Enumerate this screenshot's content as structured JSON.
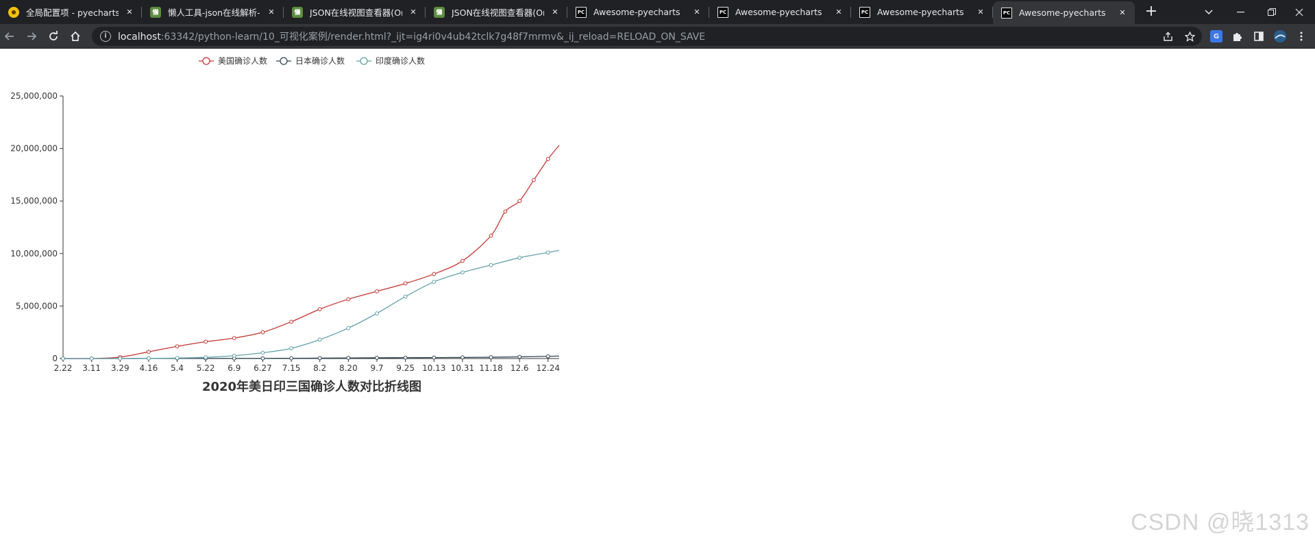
{
  "browser": {
    "tabs": [
      {
        "title": "全局配置项 - pyecharts -",
        "favicon": "pyecharts-yellow-icon",
        "active": false
      },
      {
        "title": "懒人工具-json在线解析-在",
        "favicon": "lazy-tool-green-icon",
        "active": false
      },
      {
        "title": "JSON在线视图查看器(Onl",
        "favicon": "lazy-tool-green-icon",
        "active": false
      },
      {
        "title": "JSON在线视图查看器(Onl",
        "favicon": "lazy-tool-green-icon",
        "active": false
      },
      {
        "title": "Awesome-pyecharts",
        "favicon": "pycharm-icon",
        "active": false
      },
      {
        "title": "Awesome-pyecharts",
        "favicon": "pycharm-icon",
        "active": false
      },
      {
        "title": "Awesome-pyecharts",
        "favicon": "pycharm-icon",
        "active": false
      },
      {
        "title": "Awesome-pyecharts",
        "favicon": "pycharm-icon",
        "active": true
      }
    ],
    "url_host": "localhost",
    "url_rest": ":63342/python-learn/10_可视化案例/render.html?_ijt=ig4ri0v4ub42tclk7g48f7mrmv&_ij_reload=RELOAD_ON_SAVE"
  },
  "chart_data": {
    "type": "line",
    "title": "2020年美日印三国确诊人数对比折线图",
    "legend_position": "top-left",
    "ylim": [
      0,
      25000000
    ],
    "yticks": [
      "0",
      "5,000,000",
      "10,000,000",
      "15,000,000",
      "20,000,000",
      "25,000,000"
    ],
    "ytick_values": [
      0,
      5000000,
      10000000,
      15000000,
      20000000,
      25000000
    ],
    "x_tick_labels": [
      "2.22",
      "3.11",
      "3.29",
      "4.16",
      "5.4",
      "5.22",
      "6.9",
      "6.27",
      "7.15",
      "8.2",
      "8.20",
      "9.7",
      "9.25",
      "10.13",
      "10.31",
      "11.18",
      "12.6",
      "12.24"
    ],
    "x_tick_days": [
      53,
      71,
      89,
      107,
      125,
      143,
      161,
      179,
      197,
      215,
      233,
      251,
      269,
      287,
      305,
      323,
      341,
      359
    ],
    "x_range_days": [
      53,
      366
    ],
    "series": [
      {
        "name": "美国确诊人数",
        "color": "#c23531",
        "x_days": [
          53,
          71,
          89,
          107,
          125,
          143,
          161,
          179,
          197,
          215,
          233,
          251,
          269,
          287,
          305,
          323,
          332,
          341,
          350,
          359,
          366
        ],
        "values": [
          15,
          1000,
          140000,
          640000,
          1160000,
          1600000,
          1950000,
          2500000,
          3500000,
          4700000,
          5650000,
          6400000,
          7150000,
          8050000,
          9300000,
          11700000,
          14000000,
          15000000,
          17000000,
          19000000,
          20300000
        ]
      },
      {
        "name": "日本确诊人数",
        "color": "#2f4554",
        "x_days": [
          53,
          71,
          89,
          107,
          125,
          143,
          161,
          179,
          197,
          215,
          233,
          251,
          269,
          287,
          305,
          323,
          341,
          359,
          366
        ],
        "values": [
          100,
          600,
          1900,
          9000,
          15000,
          16500,
          17000,
          18500,
          24000,
          38000,
          58000,
          72000,
          81000,
          91000,
          103000,
          125000,
          162000,
          210000,
          235000
        ]
      },
      {
        "name": "印度确诊人数",
        "color": "#61a0a8",
        "x_days": [
          53,
          71,
          89,
          107,
          125,
          143,
          161,
          179,
          197,
          215,
          233,
          251,
          269,
          287,
          305,
          323,
          341,
          359,
          366
        ],
        "values": [
          3,
          60,
          1100,
          13000,
          46000,
          120000,
          270000,
          550000,
          970000,
          1800000,
          2900000,
          4300000,
          5900000,
          7300000,
          8200000,
          8900000,
          9600000,
          10100000,
          10300000
        ]
      }
    ]
  },
  "watermark": "CSDN @晓1313"
}
